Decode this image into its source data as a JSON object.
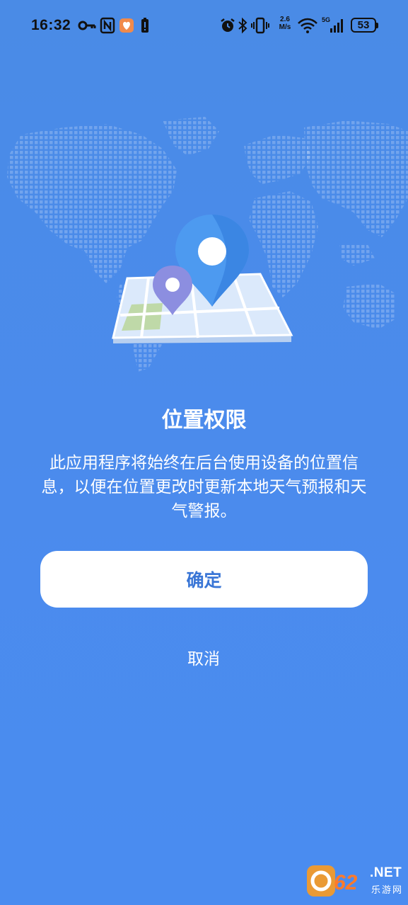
{
  "status_bar": {
    "time": "16:32",
    "net_speed_value": "2.6",
    "net_speed_unit": "M/s",
    "network": "5G",
    "battery": "53",
    "icons": [
      "key-icon",
      "nfc-icon",
      "app-notification-icon",
      "battery-alert-icon",
      "alarm-icon",
      "bluetooth-icon",
      "vibrate-icon",
      "wifi-icon",
      "signal-icon"
    ]
  },
  "dialog": {
    "title": "位置权限",
    "message": "此应用程序将始终在后台使用设备的位置信息，以便在位置更改时更新本地天气预报和天气警报。",
    "confirm_label": "确定",
    "cancel_label": "取消"
  },
  "watermark": {
    "logo_number": "962",
    "logo_suffix": ".NET",
    "site_name": "乐游网"
  },
  "colors": {
    "background": "#4a8be6",
    "button_background": "#ffffff",
    "button_text": "#3a76d6"
  }
}
